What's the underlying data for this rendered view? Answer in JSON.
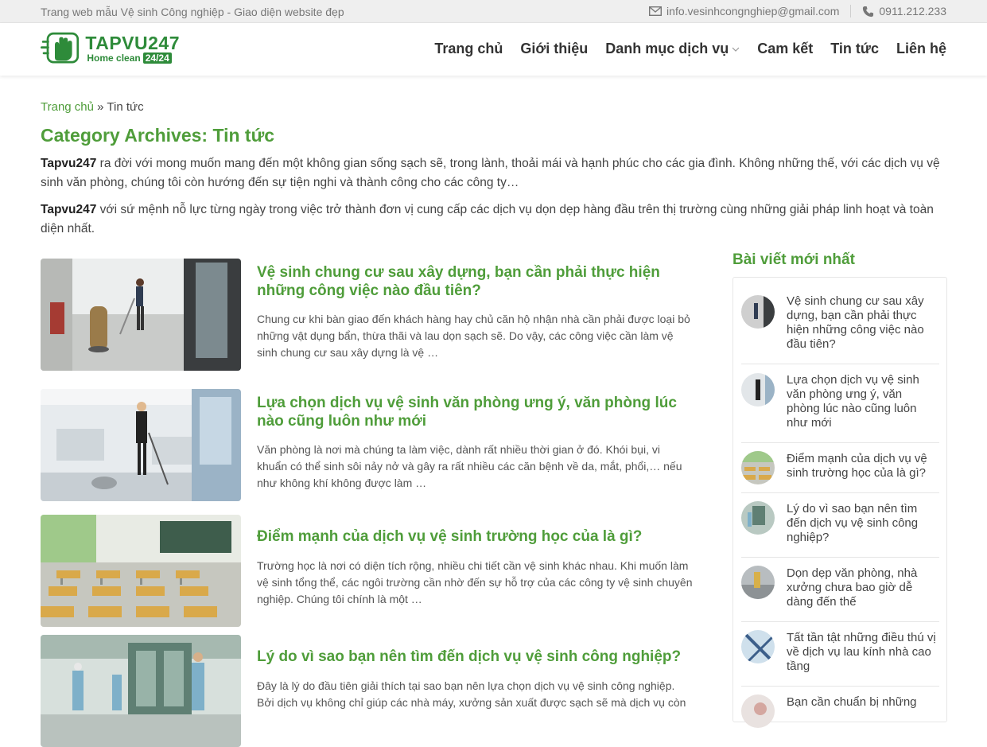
{
  "topbar": {
    "tagline": "Trang web mẫu Vệ sinh Công nghiệp - Giao diện website đẹp",
    "email": "info.vesinhcongnghiep@gmail.com",
    "phone": "0911.212.233"
  },
  "logo": {
    "title": "TAPVU247",
    "subtitle": "Home clean",
    "badge": "24/24"
  },
  "nav": {
    "items": [
      "Trang chủ",
      "Giới thiệu",
      "Danh mục dịch vụ",
      "Cam kết",
      "Tin tức",
      "Liên hệ"
    ]
  },
  "breadcrumb": {
    "home": "Trang chủ",
    "separator": "»",
    "current": "Tin tức"
  },
  "page": {
    "title": "Category Archives: Tin tức",
    "intro1_brand": "Tapvu247",
    "intro1_text": " ra đời với mong muốn mang đến một không gian sống sạch sẽ, trong lành, thoải mái và hạnh phúc cho các gia đình. Không những thế, với các dịch vụ vệ sinh văn phòng, chúng tôi còn hướng đến sự tiện nghi và thành công cho các công ty…",
    "intro2_brand": "Tapvu247",
    "intro2_text": " với sứ mệnh nỗ lực từng ngày trong việc trở thành đơn vị cung cấp các dịch vụ dọn dẹp hàng đầu trên thị trường cùng những giải pháp linh hoạt và toàn diện nhất."
  },
  "posts": [
    {
      "title": "Vệ sinh chung cư sau xây dựng, bạn cần phải thực hiện những công việc nào đầu tiên?",
      "excerpt": "Chung cư khi bàn giao đến khách hàng hay chủ căn hộ nhận nhà cần phải được loại bỏ những vật dụng bẩn, thừa thãi và lau dọn sạch sẽ. Do vậy, các công việc cần làm vệ sinh chung cư sau xây dựng là vệ …"
    },
    {
      "title": "Lựa chọn dịch vụ vệ sinh văn phòng ưng ý, văn phòng lúc nào cũng luôn như mới",
      "excerpt": "Văn phòng là nơi mà chúng ta làm việc, dành rất nhiều thời gian ở đó. Khói bụi, vi khuẩn có thể sinh sôi nảy nở và gây ra rất nhiều các căn bệnh về da, mắt, phổi,… nếu như không khí không được làm …"
    },
    {
      "title": "Điểm mạnh của dịch vụ vệ sinh trường học của là gì?",
      "excerpt": "Trường học là nơi có diện tích rộng, nhiều chi tiết cần vệ sinh khác nhau. Khi muốn làm vệ sinh tổng thể, các ngôi trường cần nhờ đến sự hỗ trợ của các công ty vệ sinh chuyên nghiệp. Chúng tôi chính là một …"
    },
    {
      "title": "Lý do vì sao bạn nên tìm đến dịch vụ vệ sinh công nghiệp?",
      "excerpt": "Đây là lý do đầu tiên giải thích tại sao bạn nên lựa chọn dịch vụ vệ sinh công nghiệp. Bởi dịch vụ không chỉ giúp các nhà máy, xưởng sản xuất được sạch sẽ mà dịch vụ còn"
    }
  ],
  "sidebar": {
    "title": "Bài viết mới nhất",
    "items": [
      "Vệ sinh chung cư sau xây dựng, bạn cần phải thực hiện những công việc nào đầu tiên?",
      "Lựa chọn dịch vụ vệ sinh văn phòng ưng ý, văn phòng lúc nào cũng luôn như mới",
      "Điểm mạnh của dịch vụ vệ sinh trường học của là gì?",
      "Lý do vì sao bạn nên tìm đến dịch vụ vệ sinh công nghiệp?",
      "Dọn dẹp văn phòng, nhà xưởng chưa bao giờ dễ dàng đến thế",
      "Tất tần tật những điều thú vị về dịch vụ lau kính nhà cao tầng",
      "Bạn cần chuẩn bị những"
    ]
  },
  "colors": {
    "accent": "#4f9d3a",
    "brand": "#2e8b3a",
    "topbar_bg": "#efefef"
  },
  "icons": {
    "email": "envelope-icon",
    "phone": "phone-icon",
    "dropdown": "chevron-down-icon"
  }
}
